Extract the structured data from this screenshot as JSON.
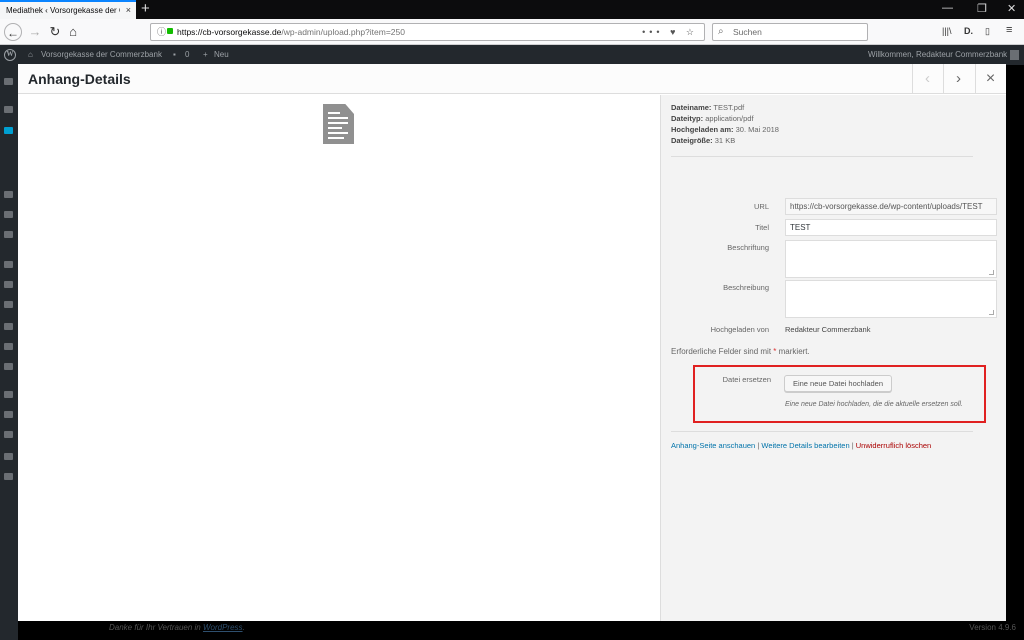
{
  "browser": {
    "tab_title": "Mediathek ‹ Vorsorgekasse der Cor",
    "tab_close": "×",
    "new_tab": "+",
    "url_host": "https://cb-vorsorgekasse.de",
    "url_path": "/wp-admin/upload.php?item=250",
    "url_actions": "••• ♥ ☆",
    "search_placeholder": "Suchen",
    "win_min": "—",
    "win_restore": "❐",
    "win_close": "✕",
    "library_icon": "|||\\",
    "reader_icon": "D.",
    "sidebar_icon": "▯",
    "menu_icon": "≡"
  },
  "adminbar": {
    "site_name": "Vorsorgekasse der Commerzbank",
    "comments_count": "0",
    "new_label": "Neu",
    "welcome": "Willkommen, Redakteur Commerzbank"
  },
  "modal": {
    "title": "Anhang-Details",
    "prev_label": "‹",
    "next_label": "›",
    "close_label": "×"
  },
  "file_info": {
    "filename_label": "Dateiname:",
    "filename": "TEST.pdf",
    "filetype_label": "Dateityp:",
    "filetype": "application/pdf",
    "uploaded_label": "Hochgeladen am:",
    "uploaded": "30. Mai 2018",
    "size_label": "Dateigröße:",
    "size": "31 KB"
  },
  "fields": {
    "url_label": "URL",
    "url_value": "https://cb-vorsorgekasse.de/wp-content/uploads/TEST",
    "title_label": "Titel",
    "title_value": "TEST",
    "caption_label": "Beschriftung",
    "description_label": "Beschreibung",
    "uploaded_by_label": "Hochgeladen von",
    "uploaded_by_value": "Redakteur Commerzbank"
  },
  "required_note": {
    "text": "Erforderliche Felder sind mit",
    "star": "*",
    "suffix": "markiert."
  },
  "replace": {
    "label": "Datei ersetzen",
    "button": "Eine neue Datei hochladen",
    "hint": "Eine neue Datei hochladen, die die aktuelle ersetzen soll."
  },
  "actions": {
    "view": "Anhang-Seite anschauen",
    "edit": "Weitere Details bearbeiten",
    "delete": "Unwiderruflich löschen",
    "divider": "|"
  },
  "footer": {
    "text": "Danke für Ihr Vertrauen in",
    "link": "WordPress",
    "version": "Version 4.9.6"
  }
}
